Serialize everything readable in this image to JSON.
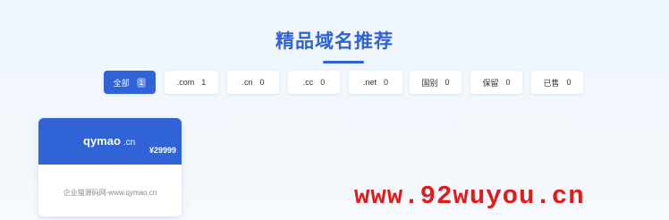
{
  "section": {
    "title": "精品域名推荐"
  },
  "filters": [
    {
      "label": "全部",
      "count": "1",
      "active": true
    },
    {
      "label": ".com",
      "count": "1"
    },
    {
      "label": ".cn",
      "count": "0"
    },
    {
      "label": ".cc",
      "count": "0"
    },
    {
      "label": ".net",
      "count": "0"
    },
    {
      "label": "国别",
      "count": "0"
    },
    {
      "label": "保留",
      "count": "0"
    },
    {
      "label": "已售",
      "count": "0"
    }
  ],
  "domain_card": {
    "name": "qymao",
    "tld": ".cn",
    "price": "¥29999",
    "description": "企业猫源码网-www.qymao.cn"
  },
  "watermark": "www.92wuyou.cn",
  "colors": {
    "accent": "#2f63d6",
    "watermark": "#e11a1a"
  }
}
